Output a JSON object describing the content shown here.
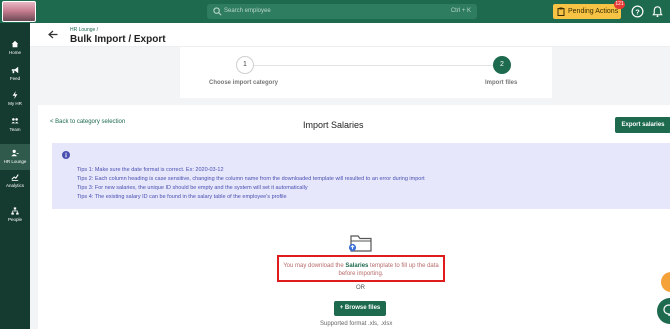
{
  "topbar": {
    "search_placeholder": "Search employee",
    "search_shortcut": "Ctrl + K",
    "pending_label": "Pending Actions",
    "pending_count": "121",
    "accent": "#1d6a4e"
  },
  "sidebar": {
    "items": [
      {
        "label": "Home",
        "icon": "home-icon"
      },
      {
        "label": "Feed",
        "icon": "megaphone-icon"
      },
      {
        "label": "My HR",
        "icon": "bolt-icon"
      },
      {
        "label": "Team",
        "icon": "team-icon"
      },
      {
        "label": "HR Lounge",
        "icon": "users-icon",
        "active": true
      },
      {
        "label": "Analytics",
        "icon": "chart-icon"
      },
      {
        "label": "People",
        "icon": "org-icon"
      }
    ]
  },
  "header": {
    "breadcrumb": "HR Lounge  /",
    "title": "Bulk Import / Export"
  },
  "stepper": {
    "step1_number": "1",
    "step1_label": "Choose import category",
    "step2_number": "2",
    "step2_label": "Import files"
  },
  "card": {
    "back_label": "< Back to category selection",
    "title": "Import Salaries",
    "export_label": "Export salaries",
    "tips": [
      "Tips 1: Make sure the date format is correct. Ex: 2020-03-12",
      "Tips 2: Each column heading is case sensitive, changing the column name from the downloaded template will resulted to an error during import",
      "Tips 3: For new salaries, the unique ID should be empty and the system will set it automatically",
      "Tips 4: The existing salary ID can be found in the salary table of the employee's profile"
    ],
    "download_msg_pre": "You may download the ",
    "download_msg_link": "Salaries",
    "download_msg_post": " template to fill up the data before importing.",
    "or_label": "OR",
    "browse_label": "+ Browse files",
    "supported_label": "Supported format .xls, .xlsx"
  }
}
